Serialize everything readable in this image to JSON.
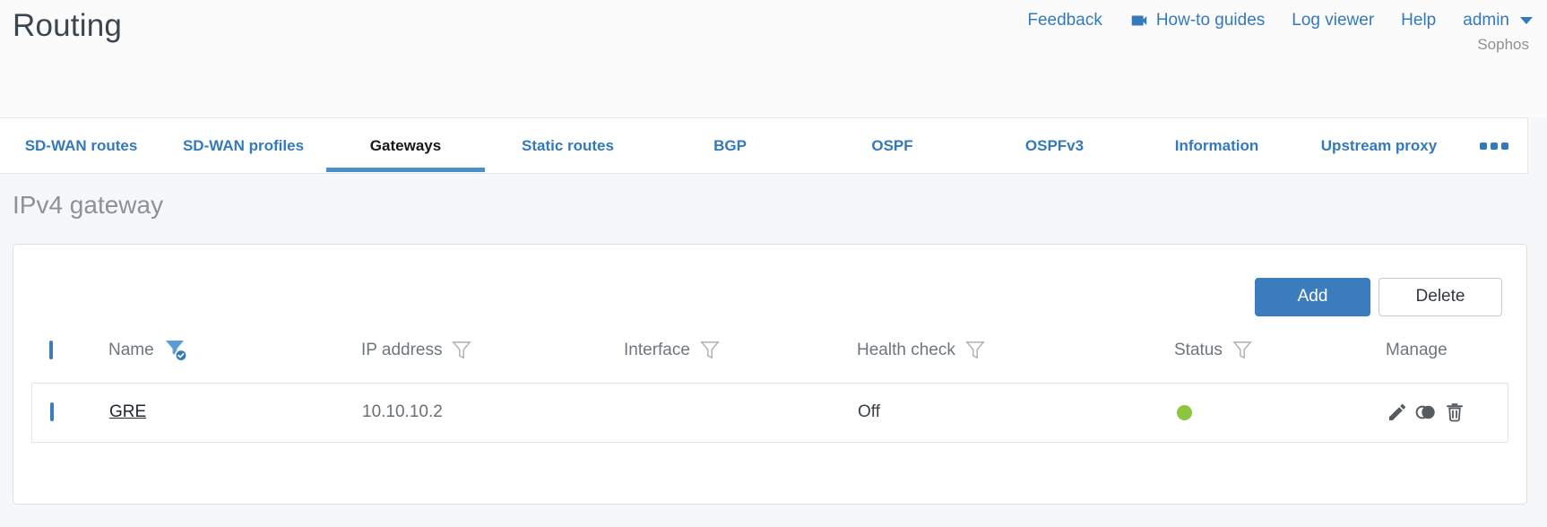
{
  "header": {
    "title": "Routing",
    "nav": {
      "feedback": "Feedback",
      "howto_guides": "How-to guides",
      "log_viewer": "Log viewer",
      "help": "Help",
      "user": "admin",
      "brand": "Sophos"
    }
  },
  "tabs": {
    "items": [
      {
        "label": "SD-WAN routes",
        "active": false
      },
      {
        "label": "SD-WAN profiles",
        "active": false
      },
      {
        "label": "Gateways",
        "active": true
      },
      {
        "label": "Static routes",
        "active": false
      },
      {
        "label": "BGP",
        "active": false
      },
      {
        "label": "OSPF",
        "active": false
      },
      {
        "label": "OSPFv3",
        "active": false
      },
      {
        "label": "Information",
        "active": false
      },
      {
        "label": "Upstream proxy",
        "active": false
      }
    ],
    "more_icon": "ellipsis-icon"
  },
  "section": {
    "heading": "IPv4 gateway"
  },
  "toolbar": {
    "add_label": "Add",
    "delete_label": "Delete"
  },
  "table": {
    "columns": [
      {
        "label": "Name",
        "filter": "active"
      },
      {
        "label": "IP address",
        "filter": "inactive"
      },
      {
        "label": "Interface",
        "filter": "inactive"
      },
      {
        "label": "Health check",
        "filter": "inactive"
      },
      {
        "label": "Status",
        "filter": "inactive"
      },
      {
        "label": "Manage",
        "filter": "none"
      }
    ],
    "rows": [
      {
        "name": "GRE",
        "ip_address": "10.10.10.2",
        "interface": "",
        "health_check": "Off",
        "status": "green-up",
        "manage_icons": [
          "edit-pencil-icon",
          "clone-icon",
          "delete-trash-icon"
        ]
      }
    ]
  },
  "colors": {
    "accent_blue": "#3279bd",
    "active_tab_underline": "#4a8ecb",
    "add_button_bg": "#3a7cbd",
    "status_green": "#8cc63e",
    "icon_gray": "#565b60",
    "funnel_outline_gray": "#b2b6ba"
  }
}
